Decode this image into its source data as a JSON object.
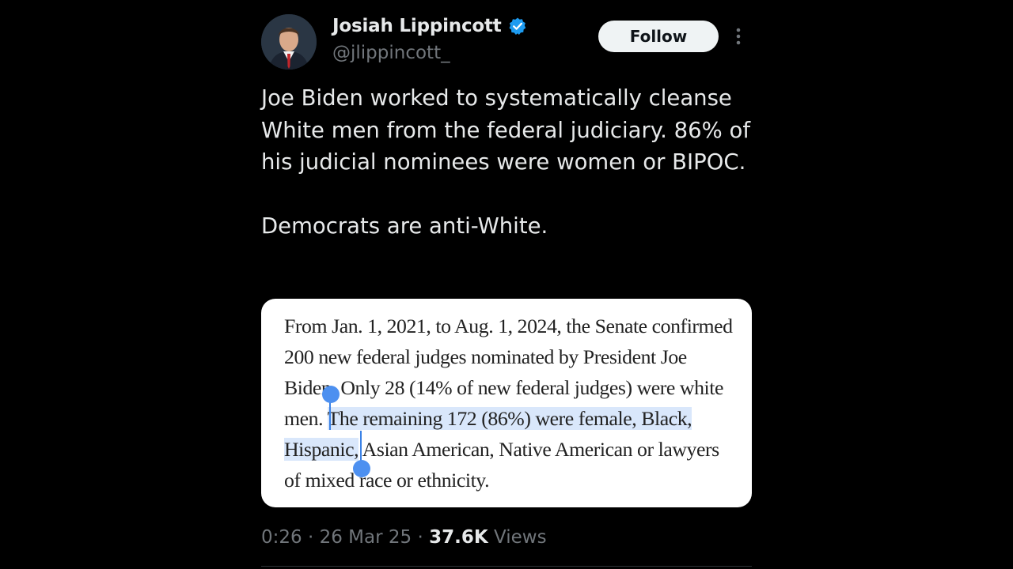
{
  "user": {
    "display_name": "Josiah Lippincott",
    "handle": "@jlippincott_",
    "verified": true
  },
  "follow_label": "Follow",
  "tweet_text": "Joe Biden worked to systematically cleanse White men from the federal judiciary. 86% of his judicial nominees were women or BIPOC.\n\nDemocrats are anti-White.",
  "article": {
    "line1": "From Jan. 1, 2021, to Aug. 1, 2024, the Senate confirmed",
    "line2": "200 new federal judges nominated by President Joe",
    "line3": "Biden. Only 28 (14% of new federal judges) were white",
    "line4_pre": "men. ",
    "line4_sel": "The remaining 172 (86%) were female, Black,",
    "line5_sel": "Hispanic,",
    "line5_post": " Asian American, Native American or lawyers",
    "line6": "of mixed race or ethnicity."
  },
  "meta": {
    "time": "0:26",
    "sep1": " · ",
    "date": "26 Mar 25",
    "sep2": " · ",
    "views_count": "37.6K",
    "views_label": " Views"
  },
  "colors": {
    "background": "#000000",
    "text": "#e7e9ea",
    "secondary_text": "#71767b",
    "verified_badge": "#1d9bf0",
    "selection_highlight": "#d9e7fb",
    "selection_handle": "#4d90f0"
  },
  "icons": {
    "verified": "verified-badge-icon",
    "more": "more-options-icon"
  }
}
